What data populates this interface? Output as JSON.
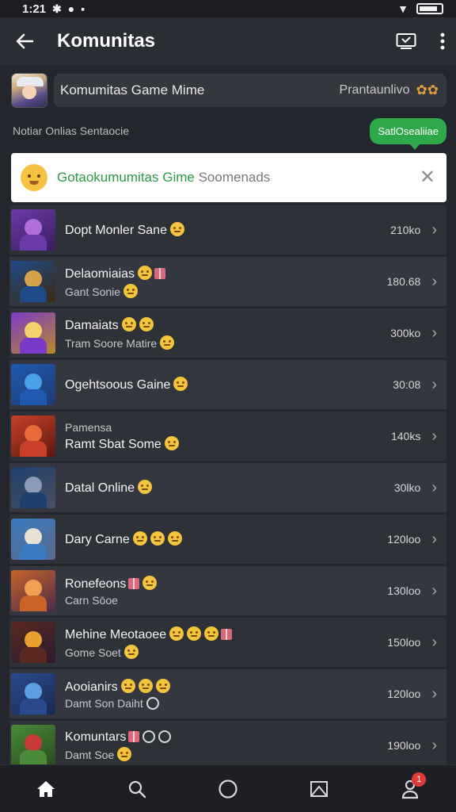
{
  "status_bar": {
    "time": "1:21"
  },
  "app_bar": {
    "title": "Komunitas"
  },
  "community": {
    "name": "Komumitas Game Mime",
    "tag": "Prantaunlivo"
  },
  "subtitle": "Notiar Onlias Sentaocie",
  "tooltip": {
    "label": "SatlOsealiiae"
  },
  "banner": {
    "text_green": "Gotaokumumitas Gime",
    "text_muted": "Soomenads"
  },
  "games": [
    {
      "title": "Dopt Monler Sane",
      "subtitle": "",
      "count": "210ko",
      "colors": [
        "#6b3aa8",
        "#b06fd8",
        "#3a1f5e"
      ]
    },
    {
      "title": "Delaomiaias",
      "subtitle": "Gant Sonie",
      "count": "180.68",
      "colors": [
        "#1f4a8a",
        "#d4a24a",
        "#3c2a12"
      ]
    },
    {
      "title": "Damaiats",
      "subtitle": "Tram Soore Matire",
      "count": "300ko",
      "colors": [
        "#7a3ac8",
        "#f2d26a",
        "#b88a2a"
      ]
    },
    {
      "title": "Ogehtsoous Gaine",
      "subtitle": "",
      "count": "30:08",
      "colors": [
        "#1f5ab0",
        "#48a0e8",
        "#203a70"
      ]
    },
    {
      "title": "Pamensa",
      "subtitle": "Ramt Sbat Some",
      "count": "140ks",
      "colors": [
        "#c8402a",
        "#e86a3a",
        "#5a1a10"
      ]
    },
    {
      "title": "Datal Online",
      "subtitle": "",
      "count": "30lko",
      "colors": [
        "#1e3f6e",
        "#8a9ab8",
        "#4a5060"
      ]
    },
    {
      "title": "Dary Carne",
      "subtitle": "",
      "count": "120loo",
      "colors": [
        "#3a7ac0",
        "#e8e0d0",
        "#5a6a8a"
      ]
    },
    {
      "title": "Ronefeons",
      "subtitle": "Carn Sōoe",
      "count": "130loo",
      "colors": [
        "#c8642a",
        "#f0a050",
        "#4a2a4a"
      ]
    },
    {
      "title": "Mehine Meotaoee",
      "subtitle": "Gome Soet",
      "count": "150loo",
      "colors": [
        "#5a2a20",
        "#e8a030",
        "#2a1a30"
      ]
    },
    {
      "title": "Aooianirs",
      "subtitle": "Damt Son Daiht",
      "count": "120loo",
      "colors": [
        "#2a4a90",
        "#58a0e0",
        "#1a2a50"
      ]
    },
    {
      "title": "Komuntars",
      "subtitle": "Damt Soe",
      "count": "190loo",
      "colors": [
        "#4a8a3a",
        "#c83a3a",
        "#2a4a20"
      ]
    }
  ],
  "nav": {
    "badge": "1"
  }
}
